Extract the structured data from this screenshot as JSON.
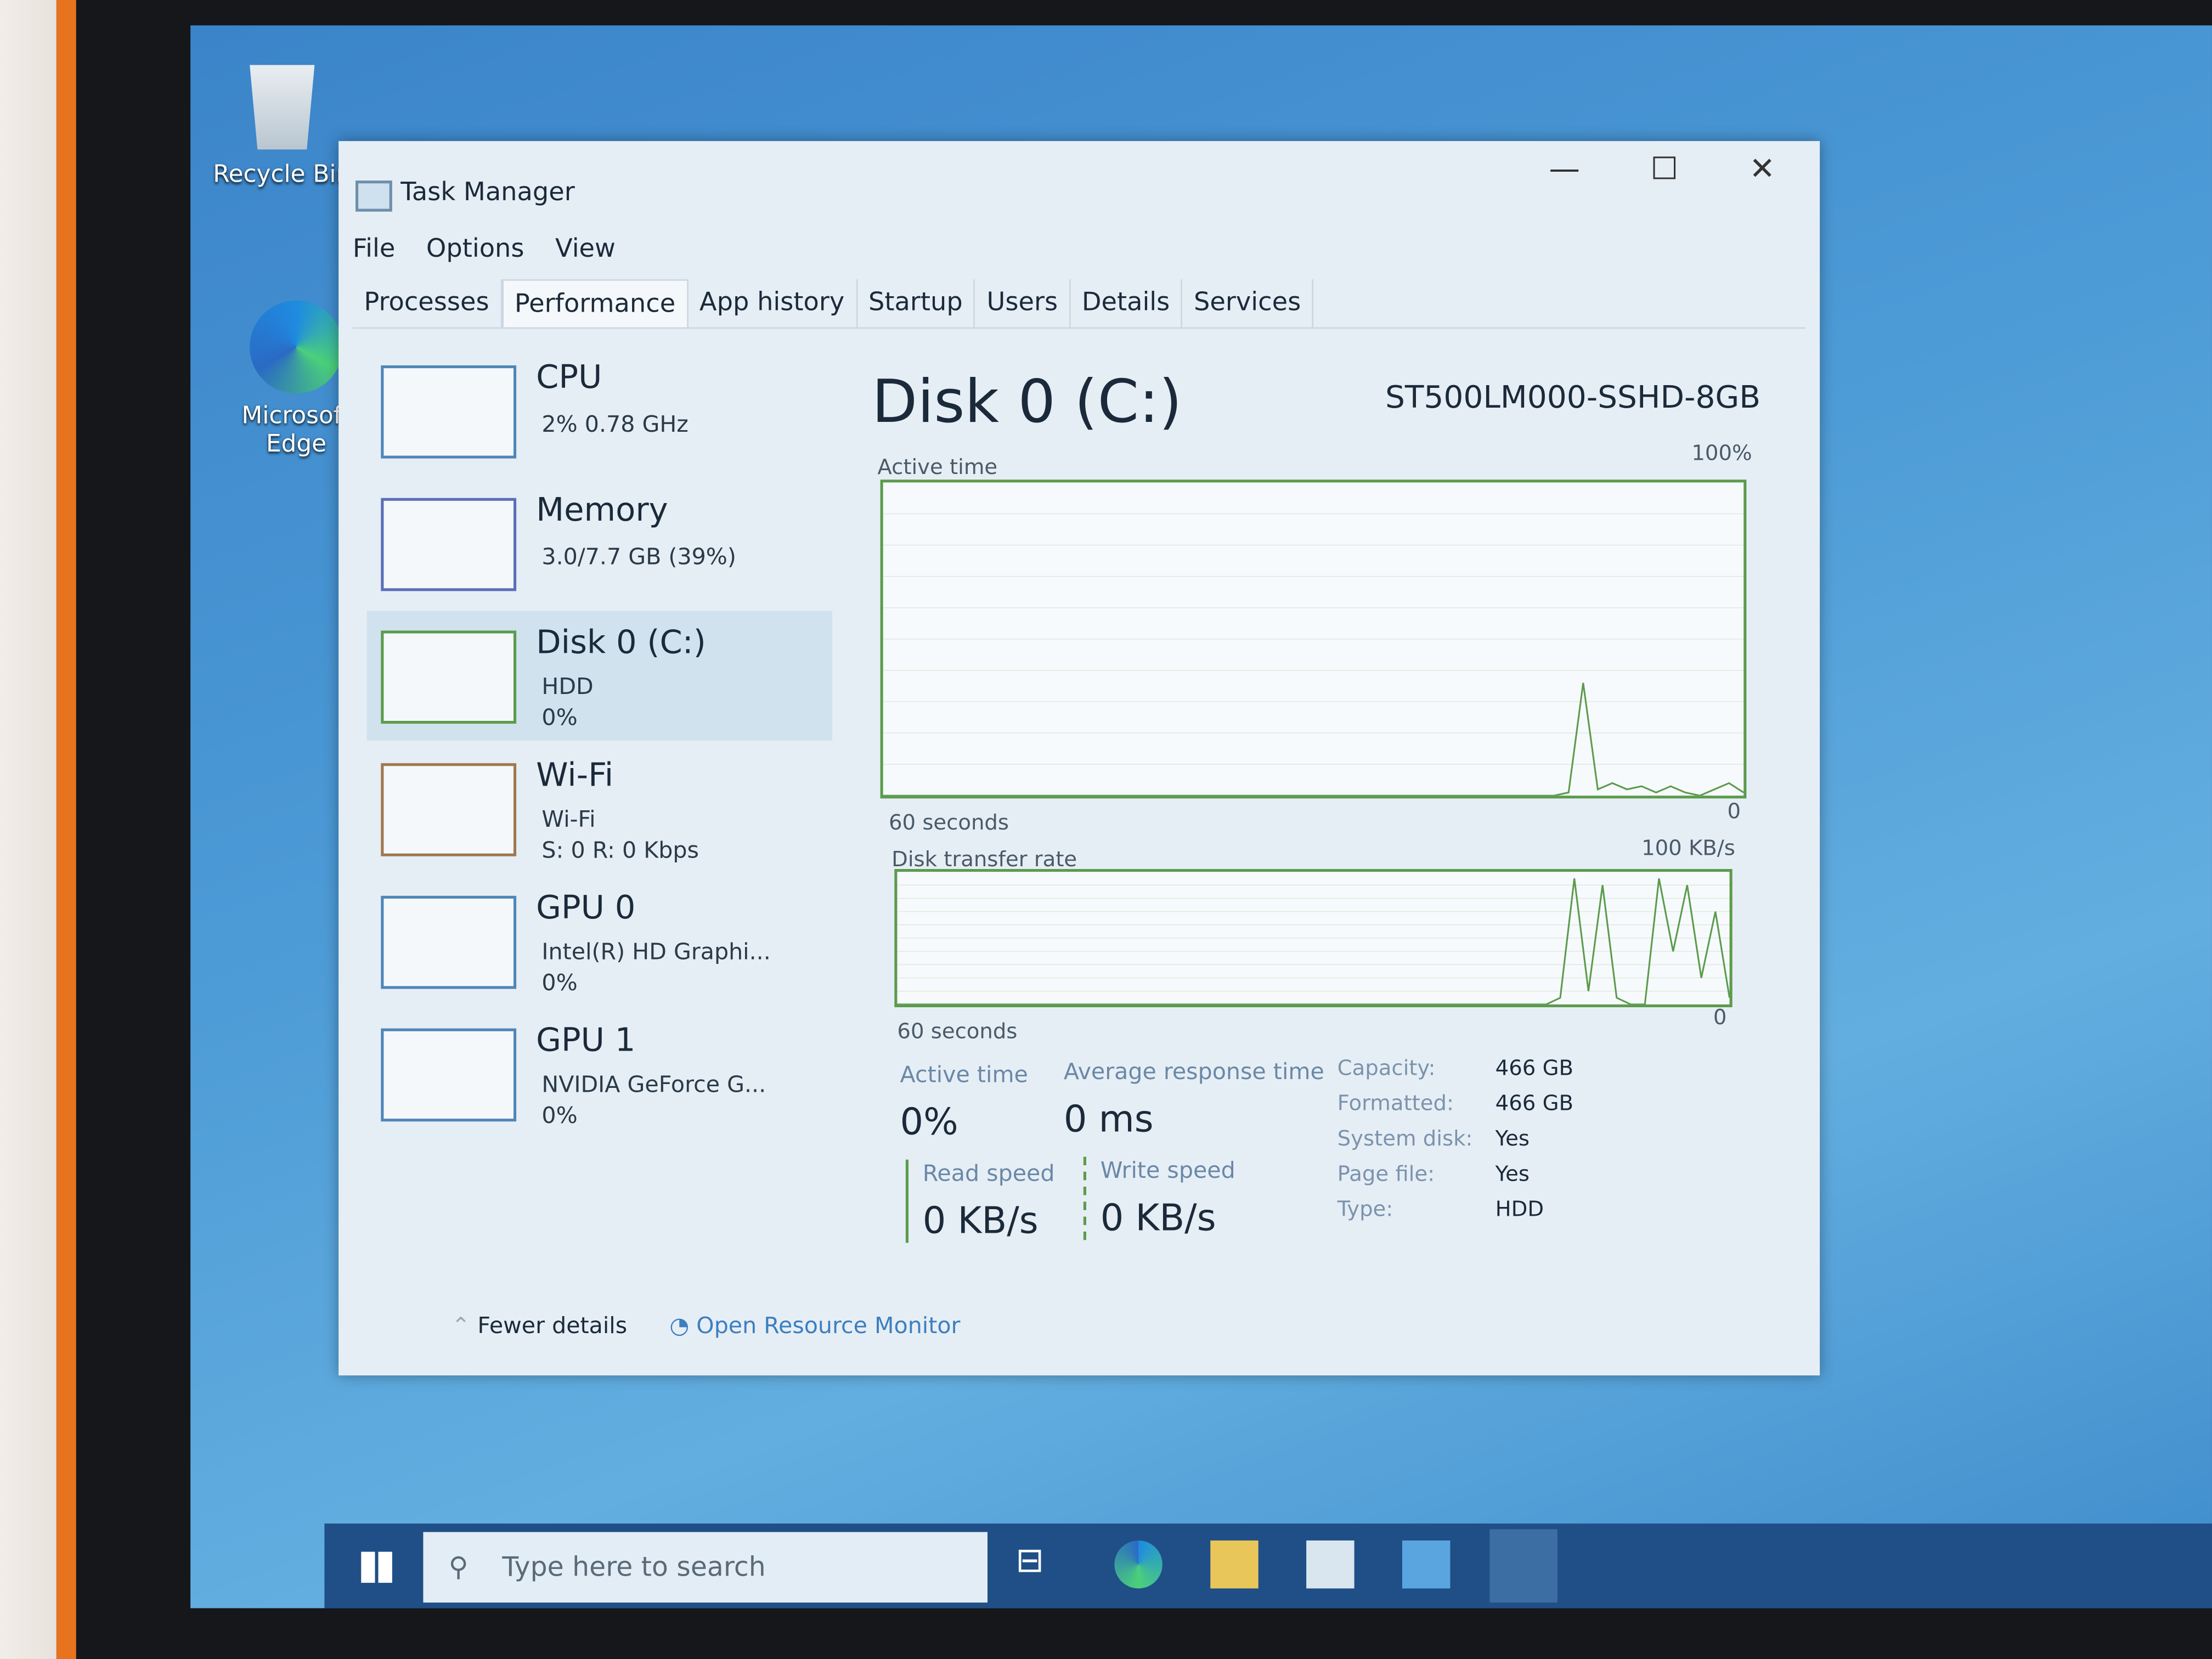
{
  "desktop": {
    "icons": [
      {
        "label": "Recycle Bin",
        "icon": "recycle-bin-icon"
      },
      {
        "label": "Microsoft Edge",
        "icon": "edge-icon"
      }
    ]
  },
  "window": {
    "title": "Task Manager",
    "controls": [
      "minimize",
      "maximize",
      "close"
    ]
  },
  "menu": [
    "File",
    "Options",
    "View"
  ],
  "tabs": [
    "Processes",
    "Performance",
    "App history",
    "Startup",
    "Users",
    "Details",
    "Services"
  ],
  "active_tab": "Performance",
  "sidebar": [
    {
      "name": "CPU",
      "sub1": "2% 0.78 GHz",
      "sub2": "",
      "color": "#4f86b8"
    },
    {
      "name": "Memory",
      "sub1": "3.0/7.7 GB (39%)",
      "sub2": "",
      "color": "#5a6fb8"
    },
    {
      "name": "Disk 0 (C:)",
      "sub1": "HDD",
      "sub2": "0%",
      "color": "#5c9b4d",
      "selected": true
    },
    {
      "name": "Wi-Fi",
      "sub1": "Wi-Fi",
      "sub2": "S: 0 R: 0 Kbps",
      "color": "#a07850"
    },
    {
      "name": "GPU 0",
      "sub1": "Intel(R) HD Graphi...",
      "sub2": "0%",
      "color": "#4f86b8"
    },
    {
      "name": "GPU 1",
      "sub1": "NVIDIA GeForce G...",
      "sub2": "0%",
      "color": "#4f86b8"
    }
  ],
  "detail": {
    "title": "Disk 0 (C:)",
    "model": "ST500LM000-SSHD-8GB",
    "graph1": {
      "label": "Active time",
      "max": "100%",
      "time": "60 seconds",
      "min": "0"
    },
    "graph2": {
      "label": "Disk transfer rate",
      "max": "100 KB/s",
      "time": "60 seconds",
      "min": "0"
    },
    "stats": {
      "active_time_label": "Active time",
      "active_time": "0%",
      "avg_resp_label": "Average response time",
      "avg_resp": "0 ms",
      "read_label": "Read speed",
      "read": "0 KB/s",
      "write_label": "Write speed",
      "write": "0 KB/s"
    },
    "props": [
      [
        "Capacity:",
        "466 GB"
      ],
      [
        "Formatted:",
        "466 GB"
      ],
      [
        "System disk:",
        "Yes"
      ],
      [
        "Page file:",
        "Yes"
      ],
      [
        "Type:",
        "HDD"
      ]
    ]
  },
  "footer": {
    "fewer": "Fewer details",
    "monitor": "Open Resource Monitor"
  },
  "taskbar": {
    "search_placeholder": "Type here to search"
  },
  "chart_data": [
    {
      "type": "line",
      "title": "Active time",
      "ylim": [
        0,
        100
      ],
      "x_span": "60 seconds",
      "values": [
        0,
        0,
        0,
        0,
        0,
        0,
        0,
        0,
        0,
        0,
        0,
        0,
        0,
        0,
        0,
        0,
        0,
        0,
        0,
        0,
        0,
        0,
        0,
        0,
        0,
        0,
        0,
        0,
        0,
        0,
        0,
        0,
        0,
        0,
        0,
        0,
        0,
        0,
        0,
        0,
        0,
        0,
        0,
        0,
        0,
        0,
        0,
        1,
        36,
        2,
        4,
        2,
        3,
        1,
        3,
        1,
        0,
        2,
        4,
        1
      ]
    },
    {
      "type": "line",
      "title": "Disk transfer rate",
      "ylim": [
        0,
        100
      ],
      "x_span": "60 seconds",
      "values": [
        0,
        0,
        0,
        0,
        0,
        0,
        0,
        0,
        0,
        0,
        0,
        0,
        0,
        0,
        0,
        0,
        0,
        0,
        0,
        0,
        0,
        0,
        0,
        0,
        0,
        0,
        0,
        0,
        0,
        0,
        0,
        0,
        0,
        0,
        0,
        0,
        0,
        0,
        0,
        0,
        0,
        0,
        0,
        0,
        0,
        0,
        0,
        5,
        95,
        10,
        90,
        5,
        0,
        0,
        95,
        40,
        90,
        20,
        70,
        5
      ]
    }
  ]
}
